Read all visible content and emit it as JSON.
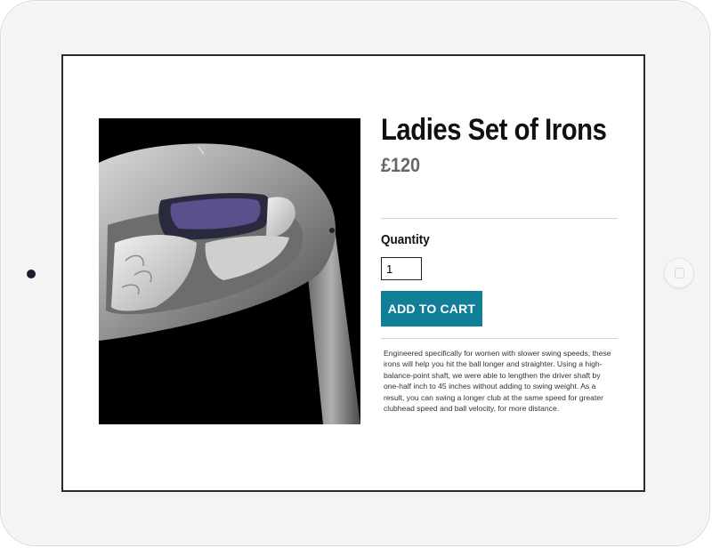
{
  "product": {
    "title": "Ladies Set of Irons",
    "price": "£120",
    "quantity_label": "Quantity",
    "quantity_value": "1",
    "add_to_cart_label": "ADD TO CART",
    "description": "Engineered specifically for women with slower swing speeds, these irons will help you hit the ball longer and straighter. Using a high-balance-point shaft, we were able to lengthen the driver shaft by one-half inch to 45 inches without adding to swing weight. As a result, you can swing a longer club at the same speed for greater clubhead speed and ball velocity, for more distance."
  },
  "colors": {
    "accent": "#127f99",
    "price": "#666666",
    "title": "#111111"
  }
}
